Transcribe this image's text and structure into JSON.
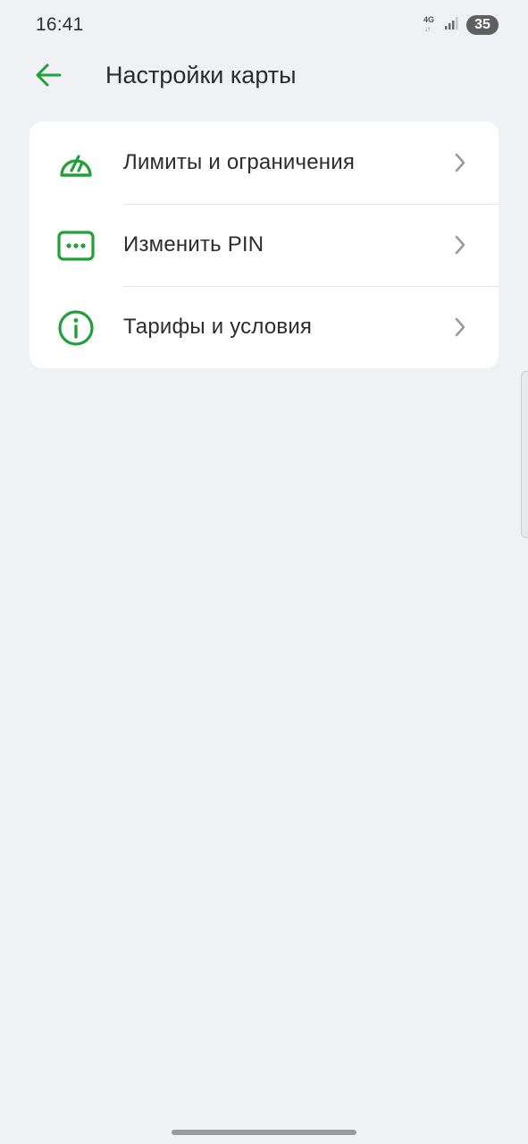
{
  "status_bar": {
    "time": "16:41",
    "network": "4G",
    "network_arrows": "↓↑",
    "battery": "35"
  },
  "header": {
    "title": "Настройки карты",
    "back_icon": "arrow-left-icon"
  },
  "settings": {
    "items": [
      {
        "label": "Лимиты и ограничения",
        "icon": "speedometer-icon"
      },
      {
        "label": "Изменить PIN",
        "icon": "pin-dots-icon"
      },
      {
        "label": "Тарифы и условия",
        "icon": "info-icon"
      }
    ]
  },
  "colors": {
    "accent": "#21a038",
    "background": "#eff1f5",
    "card": "#ffffff",
    "text": "#2d2d2d",
    "chevron": "#9b9b9b"
  }
}
